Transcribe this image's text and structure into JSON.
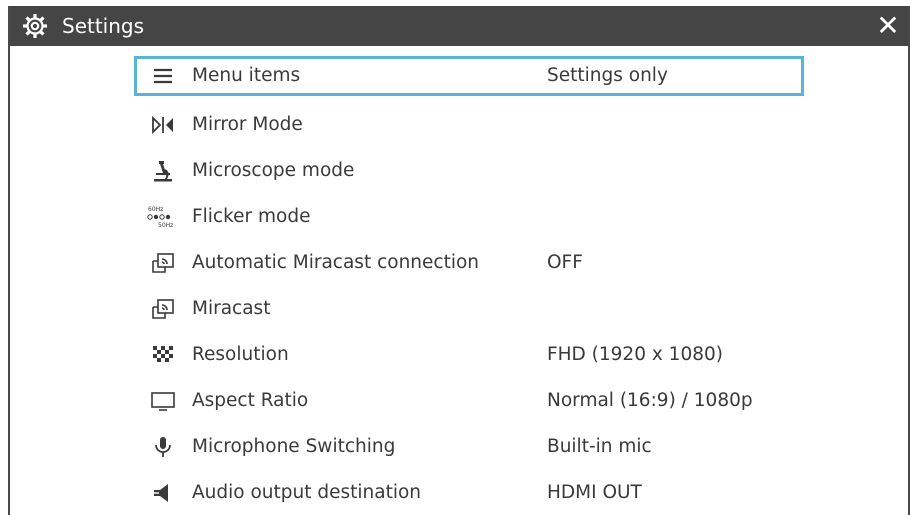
{
  "window": {
    "title": "Settings",
    "close_label": "✕"
  },
  "colors": {
    "titlebar": "#454545",
    "selection_border": "#5ab4d6",
    "text": "#3a3a3a"
  },
  "menu": {
    "items": [
      {
        "icon": "menu-icon",
        "label": "Menu items",
        "value": "Settings only"
      },
      {
        "icon": "mirror-mode-icon",
        "label": "Mirror Mode",
        "value": ""
      },
      {
        "icon": "microscope-icon",
        "label": "Microscope mode",
        "value": ""
      },
      {
        "icon": "flicker-icon",
        "label": "Flicker mode",
        "value": "",
        "icon_text": [
          "60Hz",
          "50Hz"
        ]
      },
      {
        "icon": "miracast-icon",
        "label": "Automatic Miracast connection",
        "value": "OFF"
      },
      {
        "icon": "miracast-icon",
        "label": "Miracast",
        "value": ""
      },
      {
        "icon": "resolution-icon",
        "label": "Resolution",
        "value": "FHD (1920 x 1080)"
      },
      {
        "icon": "monitor-icon",
        "label": "Aspect Ratio",
        "value": "Normal (16:9) / 1080p"
      },
      {
        "icon": "microphone-icon",
        "label": "Microphone Switching",
        "value": "Built-in mic"
      },
      {
        "icon": "speaker-icon",
        "label": "Audio output destination",
        "value": "HDMI OUT"
      }
    ]
  }
}
